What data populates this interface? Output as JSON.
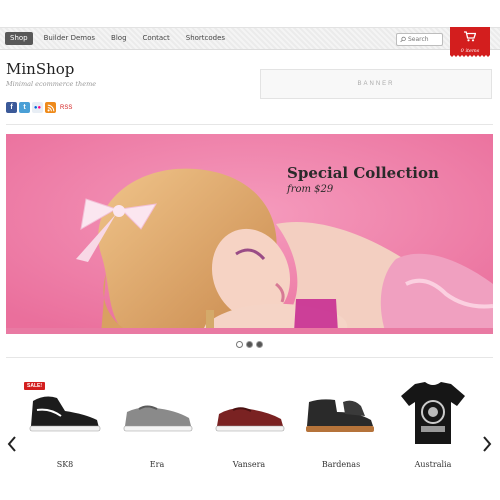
{
  "nav": {
    "items": [
      {
        "label": "Shop",
        "active": true
      },
      {
        "label": "Builder Demos",
        "active": false
      },
      {
        "label": "Blog",
        "active": false
      },
      {
        "label": "Contact",
        "active": false
      },
      {
        "label": "Shortcodes",
        "active": false
      }
    ],
    "search_placeholder": "Search",
    "cart_label": "0 items"
  },
  "header": {
    "logo": "MinShop",
    "tagline": "Minimal ecommerce theme",
    "social": [
      "facebook-icon",
      "twitter-icon",
      "flickr-icon",
      "rss-icon"
    ],
    "rss_label": "RSS",
    "banner": "BANNER"
  },
  "slider": {
    "title": "Special Collection",
    "subtitle": "from $29",
    "dots": 3,
    "active_dot": 0,
    "bg_color": "#f082aa"
  },
  "products": {
    "sale_badge": "SALE!",
    "items": [
      {
        "name": "SK8"
      },
      {
        "name": "Era"
      },
      {
        "name": "Vansera"
      },
      {
        "name": "Bardenas"
      },
      {
        "name": "Australia"
      }
    ]
  },
  "colors": {
    "accent": "#d31e1e"
  }
}
